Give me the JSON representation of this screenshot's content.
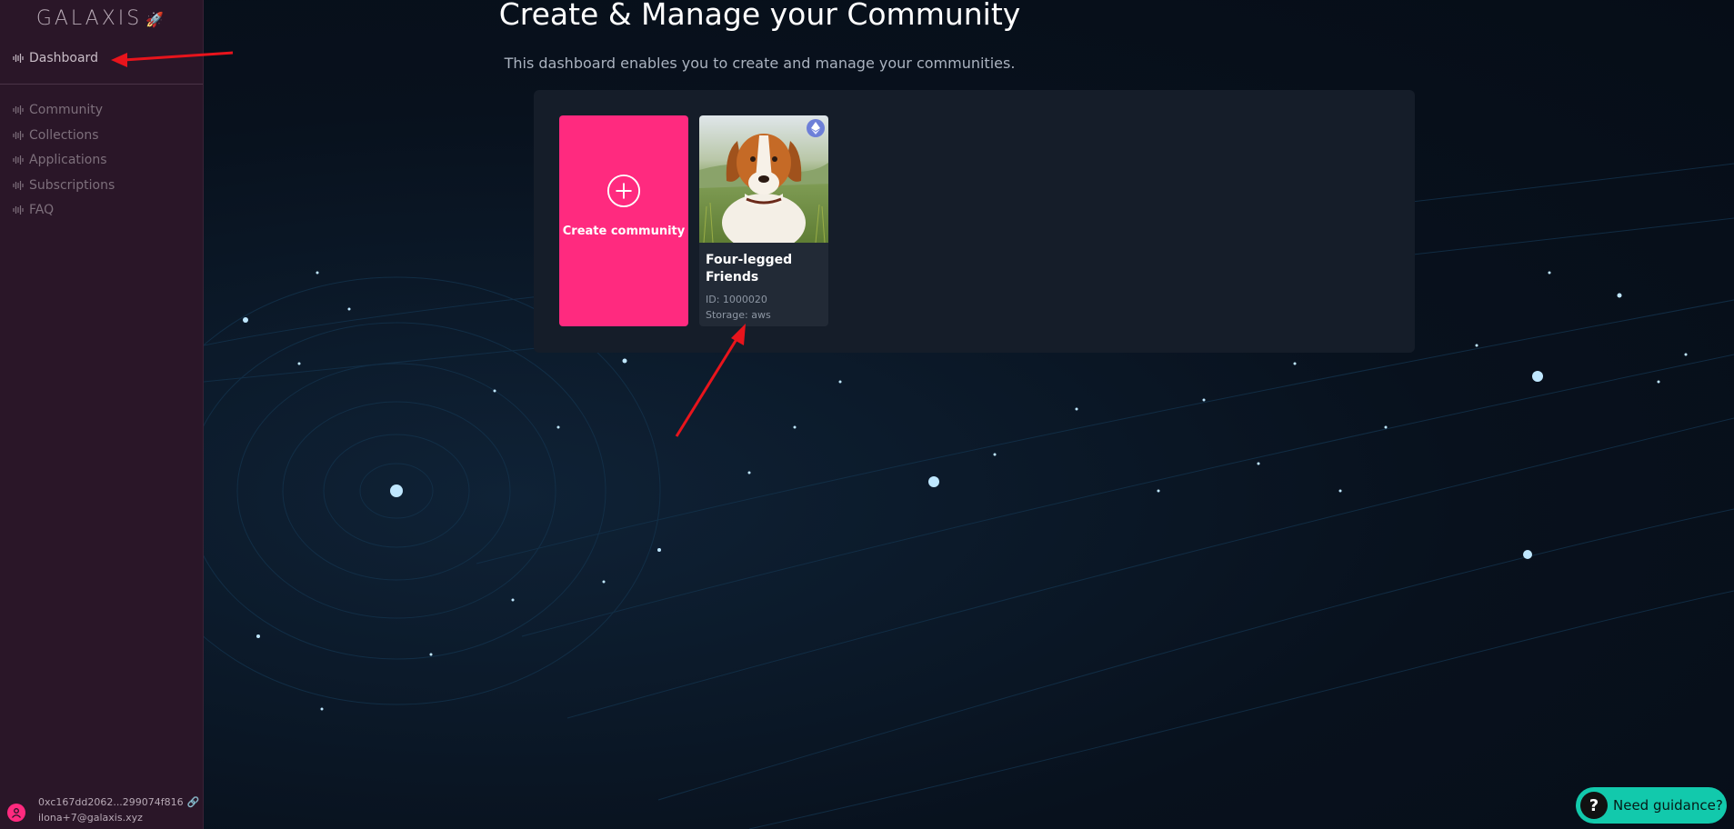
{
  "sidebar": {
    "logo": "GALAXIS",
    "items": [
      {
        "label": "Dashboard",
        "active": true
      },
      {
        "label": "Community"
      },
      {
        "label": "Collections"
      },
      {
        "label": "Applications"
      },
      {
        "label": "Subscriptions"
      },
      {
        "label": "FAQ"
      }
    ],
    "user": {
      "wallet": "0xc167dd2062...299074f816",
      "email": "ilona+7@galaxis.xyz"
    }
  },
  "main": {
    "title": "Create & Manage your Community",
    "subtitle": "This dashboard enables you to create and manage your communities.",
    "create_card": {
      "label": "Create community"
    },
    "communities": [
      {
        "name": "Four-legged Friends",
        "id": "ID: 1000020",
        "storage": "Storage: aws"
      }
    ]
  },
  "help": {
    "label": "Need guidance?"
  },
  "colors": {
    "sidebar_bg": "#2a1628",
    "accent_pink": "#ff2a7f",
    "guidance_teal": "#12c9ac",
    "panel_bg": "#151d29",
    "annotation_arrow": "#e8141c"
  },
  "icons": [
    "wave-icon",
    "rocket-icon",
    "plus-circle-icon",
    "ethereum-icon",
    "link-icon",
    "user-icon",
    "question-icon"
  ]
}
